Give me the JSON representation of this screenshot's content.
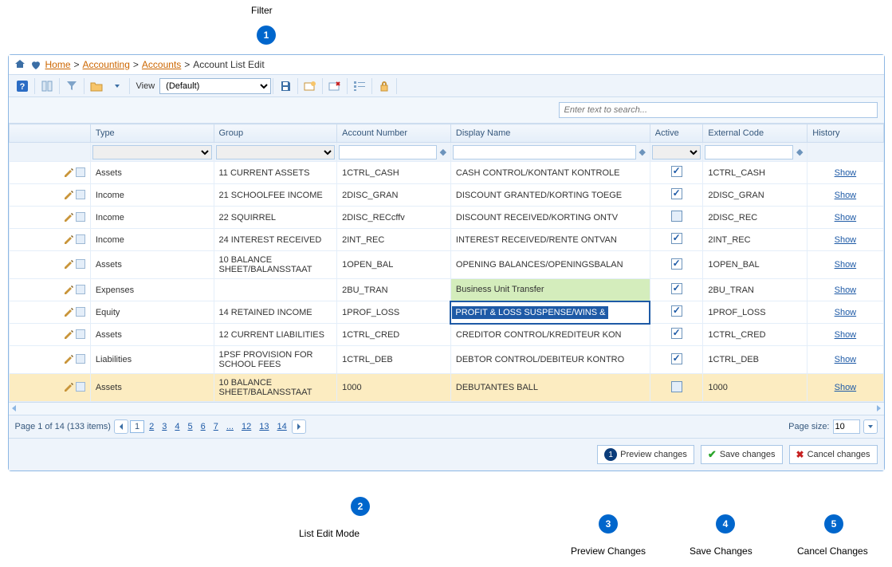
{
  "annotations": {
    "top": "Filter",
    "bottom2": "List Edit Mode",
    "bottom3": "Preview Changes",
    "bottom4": "Save Changes",
    "bottom5": "Cancel Changes"
  },
  "breadcrumb": {
    "home": "Home",
    "accounting": "Accounting",
    "accounts": "Accounts",
    "current": "Account List Edit"
  },
  "toolbar": {
    "view_label": "View",
    "view_value": "(Default)"
  },
  "search": {
    "placeholder": "Enter text to search..."
  },
  "columns": {
    "type": "Type",
    "group": "Group",
    "accnum": "Account Number",
    "dispname": "Display Name",
    "active": "Active",
    "extcode": "External Code",
    "history": "History"
  },
  "rows": [
    {
      "type": "Assets",
      "group": "11 CURRENT ASSETS",
      "acc": "1CTRL_CASH",
      "disp": "CASH CONTROL/KONTANT KONTROLE",
      "active": true,
      "ext": "1CTRL_CASH"
    },
    {
      "type": "Income",
      "group": "21 SCHOOLFEE INCOME",
      "acc": "2DISC_GRAN",
      "disp": "DISCOUNT GRANTED/KORTING TOEGE",
      "active": true,
      "ext": "2DISC_GRAN"
    },
    {
      "type": "Income",
      "group": "22 SQUIRREL",
      "acc": "2DISC_RECcffv",
      "disp": "DISCOUNT RECEIVED/KORTING ONTV",
      "active": false,
      "ext": "2DISC_REC"
    },
    {
      "type": "Income",
      "group": "24 INTEREST RECEIVED",
      "acc": "2INT_REC",
      "disp": "INTEREST RECEIVED/RENTE ONTVAN",
      "active": true,
      "ext": "2INT_REC"
    },
    {
      "type": "Assets",
      "group": "10 BALANCE SHEET/BALANSSTAAT",
      "acc": "1OPEN_BAL",
      "disp": "OPENING BALANCES/OPENINGSBALAN",
      "active": true,
      "ext": "1OPEN_BAL"
    },
    {
      "type": "Expenses",
      "group": "",
      "acc": "2BU_TRAN",
      "disp": "Business Unit Transfer",
      "active": true,
      "ext": "2BU_TRAN",
      "green": true
    },
    {
      "type": "Equity",
      "group": "14 RETAINED INCOME",
      "acc": "1PROF_LOSS",
      "disp": "PROFIT & LOSS SUSPENSE/WINS &",
      "active": true,
      "ext": "1PROF_LOSS",
      "editing": true
    },
    {
      "type": "Assets",
      "group": "12 CURRENT LIABILITIES",
      "acc": "1CTRL_CRED",
      "disp": "CREDITOR CONTROL/KREDITEUR KON",
      "active": true,
      "ext": "1CTRL_CRED"
    },
    {
      "type": "Liabilities",
      "group": "1PSF PROVISION FOR SCHOOL FEES",
      "acc": "1CTRL_DEB",
      "disp": "DEBTOR CONTROL/DEBITEUR KONTRO",
      "active": true,
      "ext": "1CTRL_DEB"
    },
    {
      "type": "Assets",
      "group": "10 BALANCE SHEET/BALANSSTAAT",
      "acc": "1000",
      "disp": "DEBUTANTES BALL",
      "active": false,
      "ext": "1000",
      "yellow": true
    }
  ],
  "show_label": "Show",
  "pager": {
    "summary": "Page 1 of 14 (133 items)",
    "pages": [
      "1",
      "2",
      "3",
      "4",
      "5",
      "6",
      "7",
      "...",
      "12",
      "13",
      "14"
    ],
    "current": "1",
    "size_label": "Page size:",
    "size_value": "10"
  },
  "actions": {
    "preview": "Preview changes",
    "save": "Save changes",
    "cancel": "Cancel changes"
  }
}
